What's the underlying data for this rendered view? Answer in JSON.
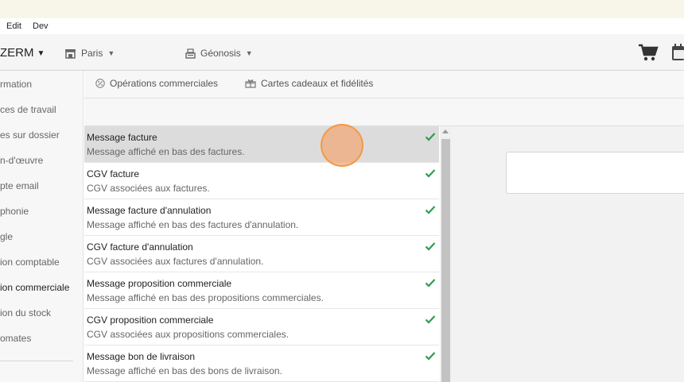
{
  "menubar": {
    "items": [
      "Edit",
      "Dev"
    ]
  },
  "appbar": {
    "brand": "ZERM",
    "location1": "Paris",
    "location2": "Géonosis",
    "cart_icon": "cart-icon",
    "calendar_icon": "calendar-icon"
  },
  "sidebar": {
    "items": [
      {
        "label": "rmation",
        "active": false
      },
      {
        "label": "ces de travail",
        "active": false
      },
      {
        "label": "es sur dossier",
        "active": false
      },
      {
        "label": "n-d'œuvre",
        "active": false
      },
      {
        "label": "pte email",
        "active": false
      },
      {
        "label": "phonie",
        "active": false
      },
      {
        "label": "gle",
        "active": false
      },
      {
        "label": "ion comptable",
        "active": false
      },
      {
        "label": "ion commerciale",
        "active": true
      },
      {
        "label": "ion du stock",
        "active": false
      },
      {
        "label": "omates",
        "active": false
      }
    ]
  },
  "tabs": [
    {
      "label": "Opérations commerciales",
      "icon": "percent-icon"
    },
    {
      "label": "Cartes cadeaux et fidélités",
      "icon": "gift-icon"
    }
  ],
  "list": {
    "rows": [
      {
        "title": "Message facture",
        "desc": "Message affiché en bas des factures.",
        "checked": true,
        "selected": true
      },
      {
        "title": "CGV facture",
        "desc": "CGV associées aux factures.",
        "checked": true,
        "selected": false
      },
      {
        "title": "Message facture d'annulation",
        "desc": "Message affiché en bas des factures d'annulation.",
        "checked": true,
        "selected": false
      },
      {
        "title": "CGV facture d'annulation",
        "desc": "CGV associées aux factures d'annulation.",
        "checked": true,
        "selected": false
      },
      {
        "title": "Message proposition commerciale",
        "desc": "Message affiché en bas des propositions commerciales.",
        "checked": true,
        "selected": false
      },
      {
        "title": "CGV proposition commerciale",
        "desc": "CGV associées aux propositions commerciales.",
        "checked": true,
        "selected": false
      },
      {
        "title": "Message bon de livraison",
        "desc": "Message affiché en bas des bons de livraison.",
        "checked": true,
        "selected": false
      }
    ]
  },
  "colors": {
    "check": "#2e9d4f",
    "selected_row": "#dcdcdc",
    "cursor_highlight": "#f0aa78"
  }
}
